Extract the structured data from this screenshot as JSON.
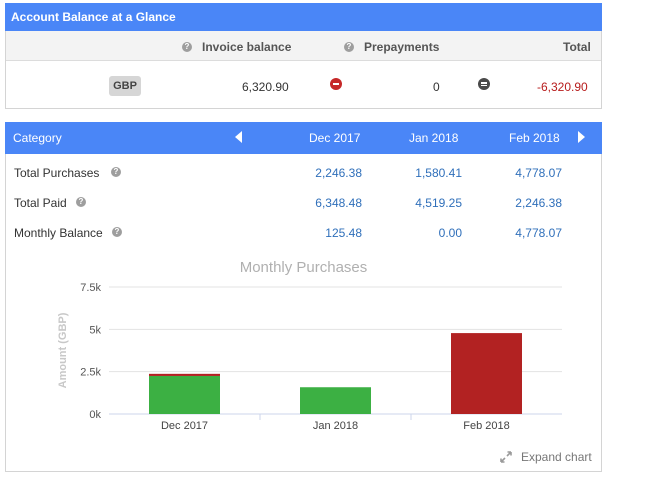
{
  "balance": {
    "title": "Account Balance at a Glance",
    "headers": {
      "invoice": "Invoice balance",
      "prepay": "Prepayments",
      "total": "Total"
    },
    "currency": "GBP",
    "invoice_value": "6,320.90",
    "prepay_value": "0",
    "total_value": "-6,320.90"
  },
  "breakdown": {
    "header": {
      "category": "Category",
      "col1": "Dec 2017",
      "col2": "Jan 2018",
      "col3": "Feb 2018"
    },
    "rows": [
      {
        "label": "Total Purchases",
        "v1": "2,246.38",
        "v2": "1,580.41",
        "v3": "4,778.07"
      },
      {
        "label": "Total Paid",
        "v1": "6,348.48",
        "v2": "4,519.25",
        "v3": "2,246.38"
      },
      {
        "label": "Monthly Balance",
        "v1": "125.48",
        "v2": "0.00",
        "v3": "4,778.07"
      }
    ]
  },
  "chart_data": {
    "type": "bar",
    "title": "Monthly Purchases",
    "xlabel": "",
    "ylabel": "Amount (GBP)",
    "categories": [
      "Dec 2017",
      "Jan 2018",
      "Feb 2018"
    ],
    "values": [
      2246.38,
      1580.41,
      4778.07
    ],
    "bar_colors": [
      "#3cb043",
      "#3cb043",
      "#b22222"
    ],
    "top_segment": {
      "category": "Dec 2017",
      "value": 125.48,
      "color": "#b22222"
    },
    "ylim": [
      0,
      7500
    ],
    "yticks": [
      0,
      2500,
      5000,
      7500
    ],
    "ytick_labels": [
      "0k",
      "2.5k",
      "5k",
      "7.5k"
    ],
    "grid": true
  },
  "expand_label": "Expand chart",
  "colors": {
    "header_blue": "#4a86f7",
    "link_blue": "#2f6fba",
    "negative_red": "#b71c1c",
    "bar_green": "#3cb043",
    "bar_red": "#b22222"
  }
}
